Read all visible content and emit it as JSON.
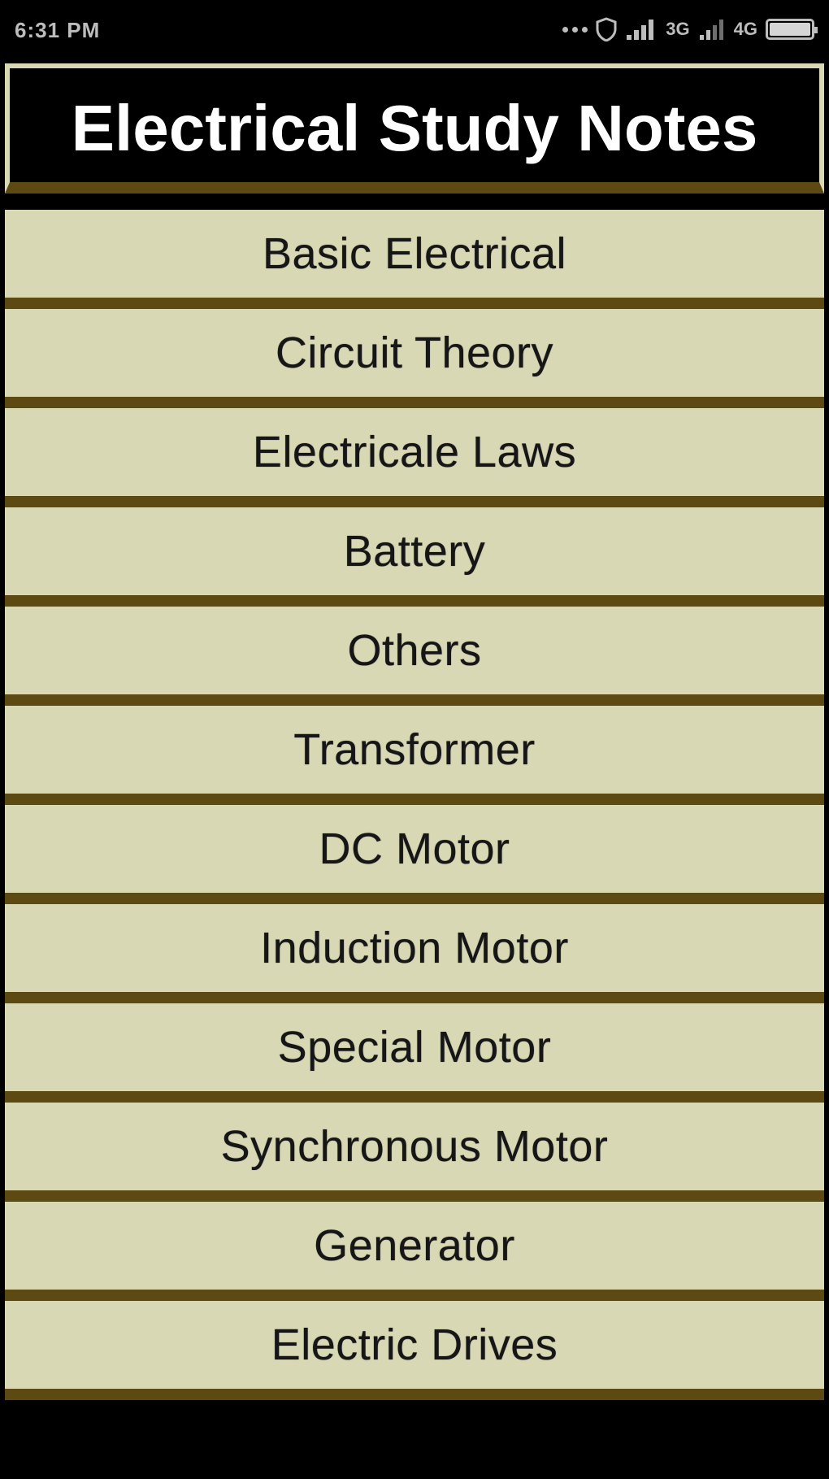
{
  "status_bar": {
    "time": "6:31 PM",
    "network_1": "4G",
    "network_2": "3G",
    "icons": [
      "more-dots-icon",
      "shield-icon",
      "signal-icon",
      "signal-icon",
      "battery-icon"
    ],
    "battery_level": 1.0
  },
  "header": {
    "title": "Electrical Study Notes"
  },
  "menu": {
    "items": [
      {
        "label": "Basic Electrical"
      },
      {
        "label": "Circuit Theory"
      },
      {
        "label": "Electricale Laws"
      },
      {
        "label": "Battery"
      },
      {
        "label": "Others"
      },
      {
        "label": "Transformer"
      },
      {
        "label": "DC Motor"
      },
      {
        "label": "Induction Motor"
      },
      {
        "label": "Special Motor"
      },
      {
        "label": "Synchronous Motor"
      },
      {
        "label": "Generator"
      },
      {
        "label": "Electric Drives"
      }
    ]
  },
  "colors": {
    "item_background": "#d9d8b5",
    "divider": "#5c4a12",
    "header_background": "#000000",
    "header_text": "#ffffff"
  }
}
